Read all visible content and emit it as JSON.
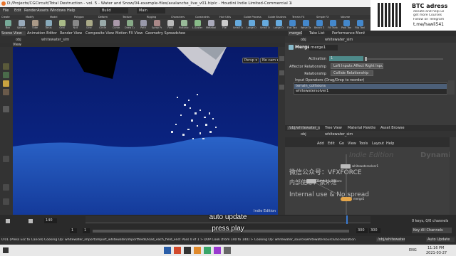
{
  "window": {
    "title": "D:/Projects/CGCircuit/Total Destruction - vol. 5 - Water and Snow/04-example-files/avalanche_live_v01.hiplc - Houdini Indie Limited-Commercial 18.5.408"
  },
  "menubar": {
    "items": [
      "File",
      "Edit",
      "Render",
      "Assets",
      "Windows",
      "Help"
    ],
    "build": "Build",
    "desktop": "Main"
  },
  "shelf": {
    "tabs": [
      "Create",
      "Modify",
      "Model",
      "Polygon",
      "Deform",
      "Texture",
      "Rigging",
      "Characters",
      "Constraints",
      "Hair Utils",
      "Guide Process",
      "Guide Brushes",
      "Terrain FX",
      "Simple FX",
      "Volume"
    ],
    "tools": [
      "Box",
      "Sphere",
      "Tube",
      "Torus",
      "Grid",
      "Null",
      "Line",
      "Circle",
      "Curve",
      "Draw Curve",
      "Path",
      "Spray Paint",
      "Font",
      "Platonic Solids",
      "L-System",
      "Metaball",
      "File",
      "Small Ocean",
      "Large Ocean",
      "Small Ocean Swell",
      "Large Ocean Swell",
      "Flat Tank",
      "Wave Tank",
      "Beach Tank",
      "Fill Tank",
      "Pool Tank",
      "Flip Tank"
    ]
  },
  "btc": {
    "title": "BTC adress",
    "line1": "donate and help us",
    "line2": "get more Courses",
    "line3": "Follow on Telegram",
    "link": "t.me/hawli541"
  },
  "left_tabs": [
    "Scene View",
    "Animation Editor",
    "Render View",
    "Composite View",
    "Motion FX View",
    "Geometry Spreadsheet"
  ],
  "viewer": {
    "path": "obj",
    "node": "whitewater_sim",
    "label": "View",
    "persp": "Persp ▾",
    "cam": "No cam ▾",
    "watermark": "Indie Edition"
  },
  "right_top": {
    "tabs": [
      "merge1",
      "Take List",
      "Performance Monitor"
    ],
    "path": "obj",
    "node": "whitewater_sim",
    "node_type": "Merge",
    "node_name": "merge1",
    "activation_label": "Activation",
    "activation_value": "1",
    "affector_label": "Affector Relationship",
    "affector_value": "Left Inputs Affect Right Inputs",
    "relationship_label": "Relationship",
    "relationship_value": "Collide Relationship",
    "input_ops_label": "Input Operators (Drag/Drop to reorder)",
    "inputs": [
      "terrain_collisions",
      "whitewatersolver1"
    ]
  },
  "network": {
    "tabs": [
      "/obj/whitewater_sim",
      "Tree View",
      "Material Palette",
      "Asset Browser"
    ],
    "path": "obj",
    "node": "whitewater_sim",
    "menus": [
      "Add",
      "Edit",
      "Go",
      "View",
      "Tools",
      "Layout",
      "Help"
    ],
    "watermark1": "Indie Edition",
    "watermark2": "Dynamics",
    "cn_text1": "微信公众号：VFXFORCE",
    "cn_text2": "内部使用 严禁外泄",
    "en_text": "Internal use & No spread",
    "nodes": [
      "whitewatersolver1",
      "terrain_collisions",
      "merge1",
      "output"
    ]
  },
  "timeline": {
    "frame": "140",
    "start": "1",
    "end1": "1",
    "range_end": "300",
    "range_end2": "300",
    "keys": "0 keys, 0/0 channels",
    "key_all": "Key All Channels",
    "auto_update": "Auto Update"
  },
  "subtitles": {
    "line1": "auto update",
    "line2": "press play"
  },
  "status": {
    "text": "0:01 (Press Esc to Cancel) Cooking Op: whitewater_import/import_whitewater/importfields/load_each_field_end: Pass 0 of 1 > DOP Cook (from 140 to 140) > Cooking Op: whitewater_source/whitewatersource/acceleration",
    "obj_path": "/obj/whitewater_sim"
  },
  "taskbar": {
    "lang": "ENG",
    "time": "11:16 PM",
    "date": "2021-03-27"
  },
  "colors": {
    "viewport_top": "#0a1a5a",
    "viewport_water": "#1a4fb0",
    "activation_bar": "#4e8a8a",
    "node_orange": "#e5a64a"
  }
}
